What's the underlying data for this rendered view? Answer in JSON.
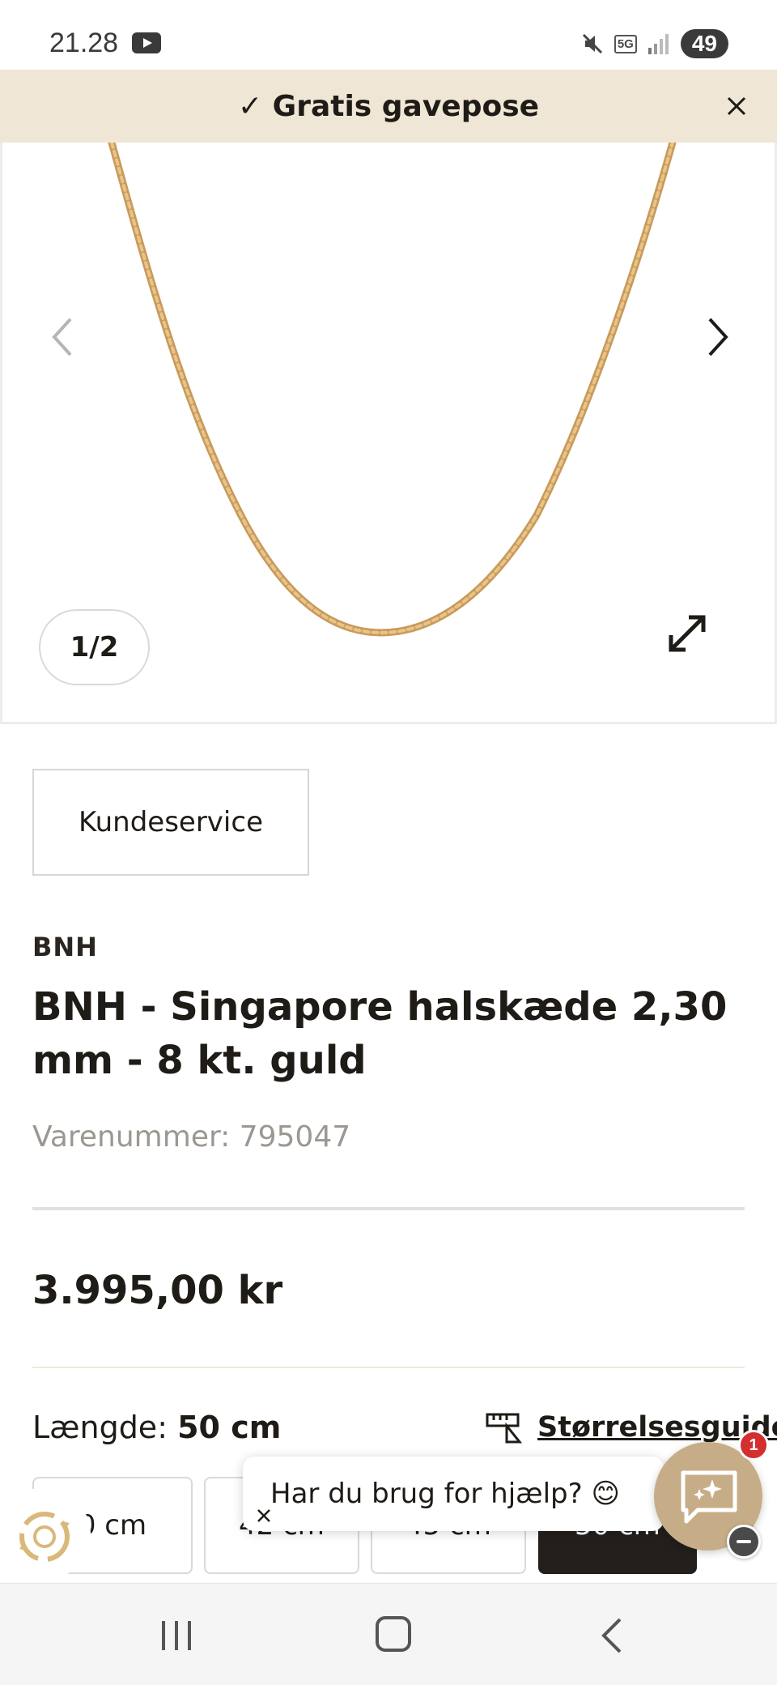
{
  "status_bar": {
    "time": "21.28",
    "network": "5G",
    "battery": "49",
    "icons": [
      "youtube-icon",
      "mute-icon",
      "signal-icon"
    ]
  },
  "promo": {
    "text": "✓ Gratis gavepose",
    "close_icon": "close-icon",
    "background": "#efe6d6"
  },
  "gallery": {
    "pager": "1/2",
    "icons": [
      "chevron-left-icon",
      "chevron-right-icon",
      "expand-icon"
    ]
  },
  "support": {
    "kundeservice_label": "Kundeservice"
  },
  "product": {
    "brand": "BNH",
    "title": "BNH - Singapore halskæde 2,30 mm - 8 kt. guld",
    "sku_label": "Varenummer: ",
    "sku_value": "795047",
    "price": "3.995,00 kr",
    "length_label": "Længde: ",
    "length_value": "50 cm",
    "size_guide_label": "Størrelsesguide",
    "size_options": [
      {
        "label": "0 cm",
        "selected": false
      },
      {
        "label": "42 cm",
        "selected": false
      },
      {
        "label": "45 cm",
        "selected": false
      },
      {
        "label": "50 cm",
        "selected": true
      }
    ]
  },
  "chat": {
    "prompt": "Har du brug for hjælp? 😊",
    "badge_count": "1",
    "accent": "#c7ad87",
    "badge_color": "#d32f2f"
  },
  "nav": {
    "icons": [
      "recents-icon",
      "home-icon",
      "back-icon"
    ]
  },
  "colors": {
    "text": "#1f1b16",
    "muted": "#9c9791",
    "selected_option": "#231f1c"
  }
}
